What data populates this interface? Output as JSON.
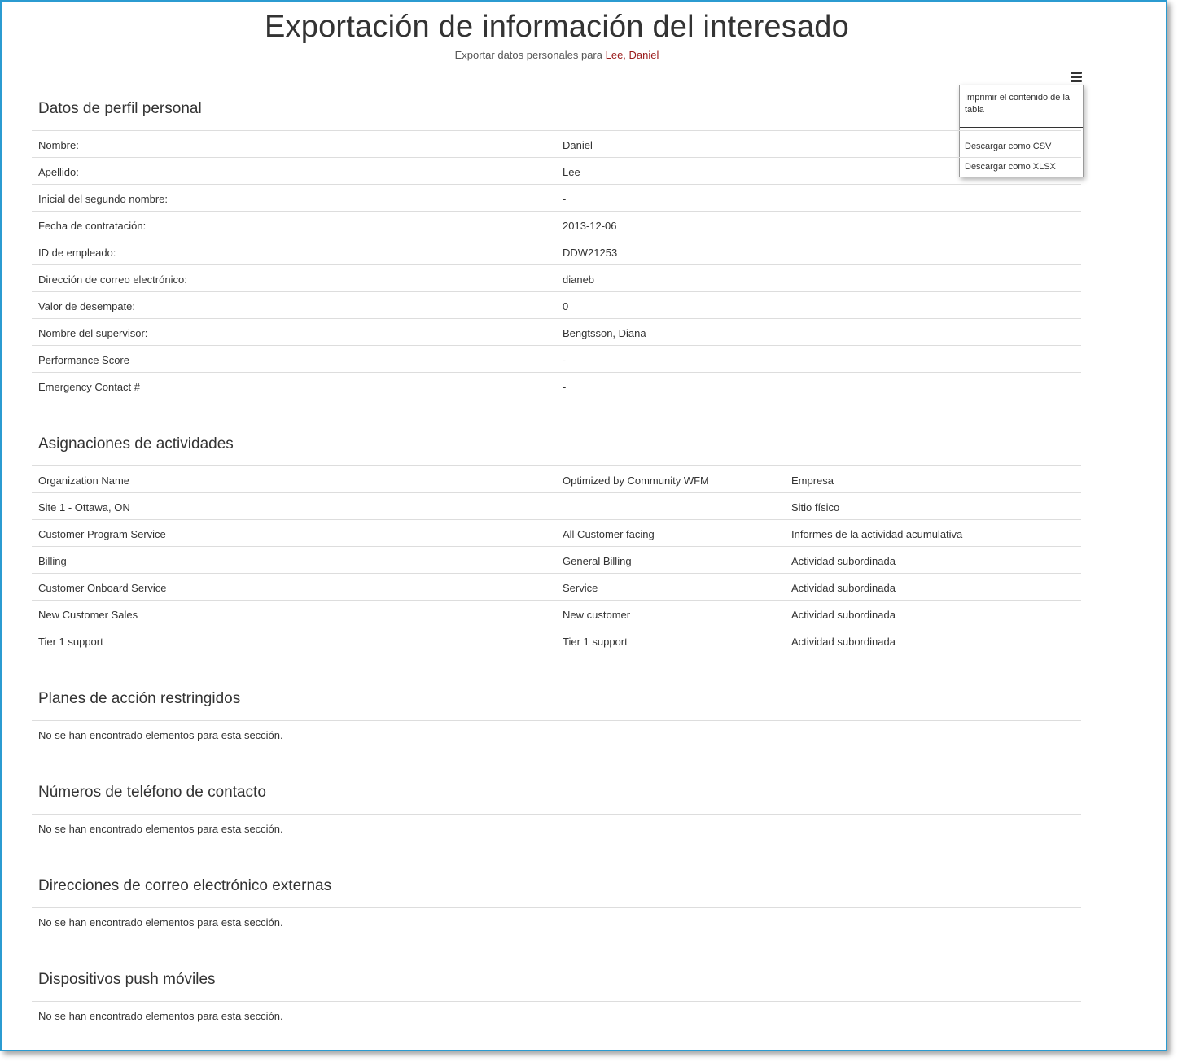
{
  "header": {
    "title": "Exportación de información del interesado",
    "subtitle_prefix": "Exportar datos personales para",
    "subject_name": "Lee, Daniel"
  },
  "menu": {
    "icon": "hamburger-menu-icon",
    "items": [
      "Imprimir el contenido de la tabla",
      "Descargar como CSV",
      "Descargar como XLSX"
    ]
  },
  "profile": {
    "title": "Datos de perfil personal",
    "rows": [
      {
        "label": "Nombre:",
        "value": "Daniel"
      },
      {
        "label": "Apellido:",
        "value": "Lee"
      },
      {
        "label": "Inicial del segundo nombre:",
        "value": "-"
      },
      {
        "label": "Fecha de contratación:",
        "value": "2013-12-06"
      },
      {
        "label": "ID de empleado:",
        "value": "DDW21253"
      },
      {
        "label": "Dirección de correo electrónico:",
        "value": "dianeb"
      },
      {
        "label": "Valor de desempate:",
        "value": "0"
      },
      {
        "label": "Nombre del supervisor:",
        "value": "Bengtsson, Diana"
      },
      {
        "label": "Performance Score",
        "value": "-"
      },
      {
        "label": "Emergency Contact #",
        "value": "-"
      }
    ]
  },
  "assignments": {
    "title": "Asignaciones de actividades",
    "rows": [
      {
        "name": "Organization Name",
        "detail": "Optimized by Community WFM",
        "type": "Empresa"
      },
      {
        "name": "Site 1 - Ottawa, ON",
        "detail": "",
        "type": "Sitio físico"
      },
      {
        "name": "Customer Program Service",
        "detail": "All Customer facing",
        "type": "Informes de la actividad acumulativa"
      },
      {
        "name": "Billing",
        "detail": "General Billing",
        "type": "Actividad subordinada"
      },
      {
        "name": "Customer Onboard Service",
        "detail": "Service",
        "type": "Actividad subordinada"
      },
      {
        "name": "New Customer Sales",
        "detail": "New customer",
        "type": "Actividad subordinada"
      },
      {
        "name": "Tier 1 support",
        "detail": "Tier 1 support",
        "type": "Actividad subordinada"
      }
    ]
  },
  "empty_sections": [
    {
      "title": "Planes de acción restringidos",
      "message": "No se han encontrado elementos para esta sección."
    },
    {
      "title": "Números de teléfono de contacto",
      "message": "No se han encontrado elementos para esta sección."
    },
    {
      "title": "Direcciones de correo electrónico externas",
      "message": "No se han encontrado elementos para esta sección."
    },
    {
      "title": "Dispositivos push móviles",
      "message": "No se han encontrado elementos para esta sección."
    }
  ]
}
